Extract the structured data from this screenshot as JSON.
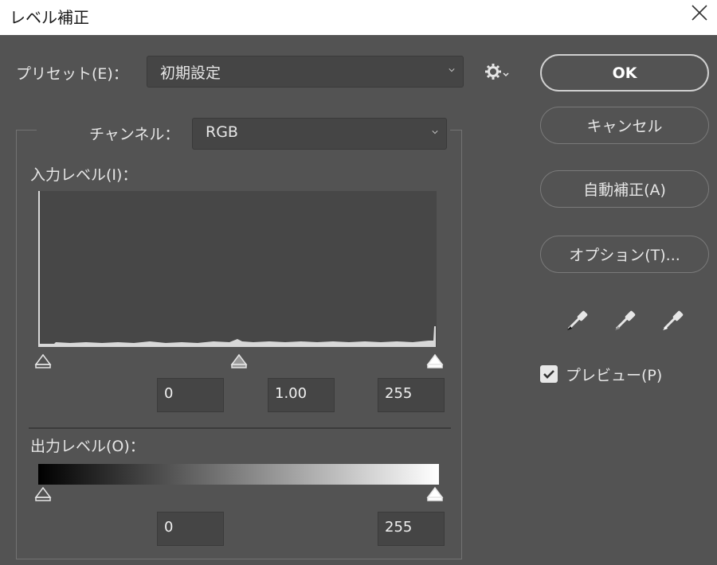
{
  "window": {
    "title": "レベル補正"
  },
  "preset": {
    "label": "プリセット(E)：",
    "value": "初期設定"
  },
  "channel": {
    "label": "チャンネル：",
    "value": "RGB"
  },
  "input_levels": {
    "label": "入力レベル(I)：",
    "black": "0",
    "gamma": "1.00",
    "white": "255"
  },
  "output_levels": {
    "label": "出力レベル(O)：",
    "black": "0",
    "white": "255"
  },
  "buttons": {
    "ok": "OK",
    "cancel": "キャンセル",
    "auto": "自動補正(A)",
    "options": "オプション(T)..."
  },
  "preview": {
    "label": "プレビュー(P)",
    "checked": true
  },
  "colors": {
    "background": "#535353",
    "field": "#454545",
    "titlebar": "#ffffff"
  },
  "icons": [
    "close-icon",
    "gear-icon",
    "chevron-down-icon",
    "black-point-eyedropper-icon",
    "gray-point-eyedropper-icon",
    "white-point-eyedropper-icon",
    "checkmark-icon"
  ]
}
